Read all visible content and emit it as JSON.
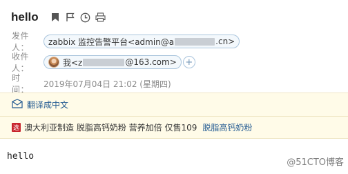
{
  "email": {
    "subject": "hello",
    "icons": [
      "bookmark-icon",
      "flag-icon",
      "clock-icon",
      "print-icon"
    ],
    "sender": {
      "label": "发件人：",
      "name_prefix": "zabbix 监控告警平台<admin@a",
      "name_suffix": ".cn>"
    },
    "recipient": {
      "label": "收件人：",
      "prefix": "我<z",
      "suffix": "@163.com>",
      "add_label": "+"
    },
    "time": {
      "label": "时　间：",
      "value": "2019年07月04日 21:02 (星期四)"
    },
    "translate": {
      "label": "翻译成中文"
    },
    "ad": {
      "badge": "选",
      "text": "澳大利亚制造 脱脂高钙奶粉 营养加倍 仅售109",
      "link": "脱脂高钙奶粉"
    },
    "body": "hello"
  },
  "watermark": "@51CTO博客",
  "colors": {
    "accent": "#245b92",
    "panel_bg": "#fffbe8",
    "chip_border": "#a9c4dc",
    "ad_badge": "#c8242c"
  }
}
